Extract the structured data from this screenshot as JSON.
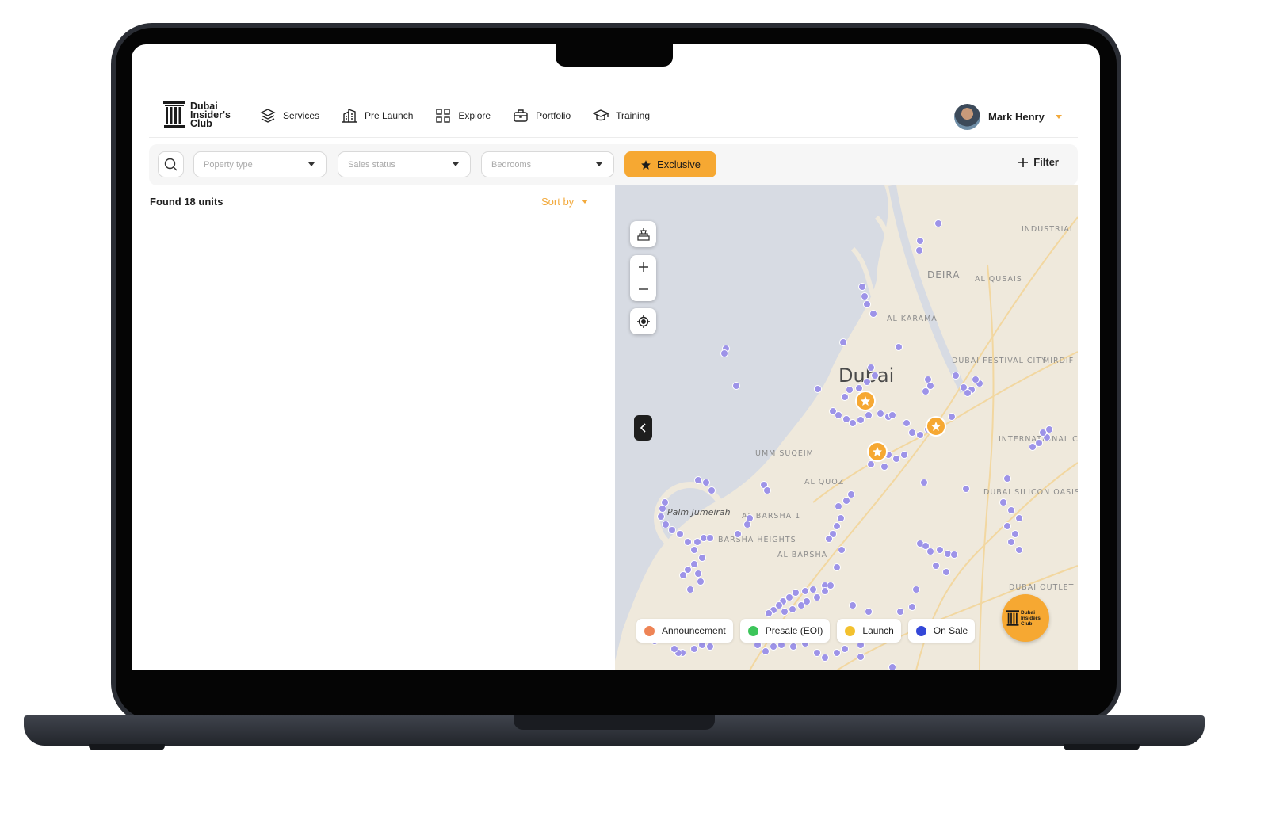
{
  "brand": {
    "name": "Dubai Insider's Club",
    "badge_text": "Dubai Insiders Club"
  },
  "nav": [
    {
      "label": "Services",
      "icon": "layers-icon"
    },
    {
      "label": "Pre Launch",
      "icon": "building-icon"
    },
    {
      "label": "Explore",
      "icon": "grid-icon"
    },
    {
      "label": "Portfolio",
      "icon": "briefcase-icon"
    },
    {
      "label": "Training",
      "icon": "graduation-cap-icon"
    }
  ],
  "user": {
    "name": "Mark Henry"
  },
  "filters": {
    "property_type_placeholder": "Poperty type",
    "sales_status_placeholder": "Sales status",
    "bedrooms_placeholder": "Bedrooms",
    "exclusive_label": "Exclusive",
    "filter_label": "Filter"
  },
  "results": {
    "summary": "Found 18 units",
    "sort_label": "Sort by"
  },
  "map": {
    "city_label": "Dubai",
    "area_labels": [
      "DEIRA",
      "AL QUSAIS",
      "INDUSTRIAL",
      "AL KARAMA",
      "DUBAI FESTIVAL CITY",
      "MIRDIF",
      "INTERNATIONAL CITY",
      "UMM SUQEIM",
      "AL QUOZ",
      "DUBAI SILICON OASIS",
      "AL BARSHA 1",
      "BARSHA HEIGHTS",
      "AL BARSHA",
      "Palm Jumeirah",
      "DUBAI OUTLET MALL"
    ],
    "legend": [
      {
        "label": "Announcement",
        "color": "#ee8456"
      },
      {
        "label": "Presale (EOI)",
        "color": "#3cc55a"
      },
      {
        "label": "Launch",
        "color": "#f3c12e"
      },
      {
        "label": "On Sale",
        "color": "#3347d8"
      }
    ],
    "colors": {
      "marker": "#9d93e8",
      "exclusive_marker": "#f6a832",
      "land": "#efe9dc",
      "water": "#d7dbe3"
    }
  }
}
